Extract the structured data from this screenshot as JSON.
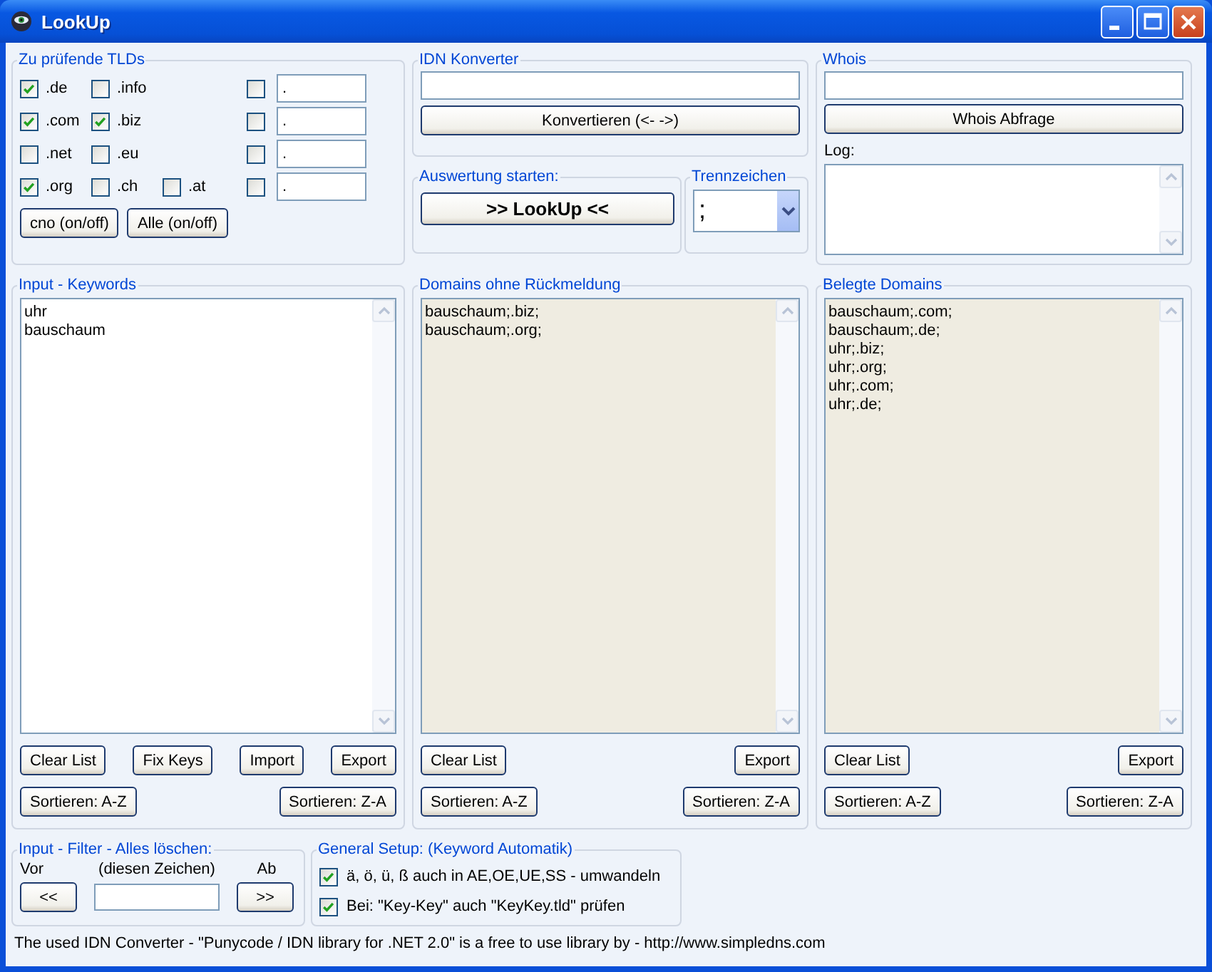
{
  "window": {
    "title": "LookUp"
  },
  "tld_group": {
    "title": "Zu prüfende TLDs",
    "rows": [
      {
        "tlds": [
          {
            "label": ".de",
            "checked": true
          },
          {
            "label": ".info",
            "checked": false
          }
        ],
        "custom": {
          "checked": false,
          "value": "."
        }
      },
      {
        "tlds": [
          {
            "label": ".com",
            "checked": true
          },
          {
            "label": ".biz",
            "checked": true
          }
        ],
        "custom": {
          "checked": false,
          "value": "."
        }
      },
      {
        "tlds": [
          {
            "label": ".net",
            "checked": false
          },
          {
            "label": ".eu",
            "checked": false
          }
        ],
        "custom": {
          "checked": false,
          "value": "."
        }
      },
      {
        "tlds": [
          {
            "label": ".org",
            "checked": true
          },
          {
            "label": ".ch",
            "checked": false
          },
          {
            "label": ".at",
            "checked": false
          }
        ],
        "custom": {
          "checked": false,
          "value": "."
        }
      }
    ],
    "buttons": [
      "cno (on/off)",
      "Alle (on/off)"
    ]
  },
  "idn": {
    "title": "IDN Konverter",
    "button": "Konvertieren (<- ->)"
  },
  "start": {
    "title": "Auswertung starten:",
    "button": ">> LookUp <<"
  },
  "separator": {
    "title": "Trennzeichen",
    "value": ";"
  },
  "whois": {
    "title": "Whois",
    "button": "Whois Abfrage",
    "log_label": "Log:"
  },
  "panels": [
    {
      "title": "Input - Keywords",
      "readonly": false,
      "lines": [
        "uhr",
        "bauschaum"
      ],
      "top_buttons": [
        "Clear List",
        "Fix Keys",
        "Import",
        "Export"
      ],
      "bottom_buttons": [
        "Sortieren: A-Z",
        "Sortieren: Z-A"
      ]
    },
    {
      "title": "Domains ohne Rückmeldung",
      "readonly": true,
      "lines": [
        "bauschaum;.biz;",
        "bauschaum;.org;"
      ],
      "top_buttons": [
        "Clear List",
        "Export"
      ],
      "bottom_buttons": [
        "Sortieren: A-Z",
        "Sortieren: Z-A"
      ]
    },
    {
      "title": "Belegte Domains",
      "readonly": true,
      "lines": [
        "bauschaum;.com;",
        "bauschaum;.de;",
        "uhr;.biz;",
        "uhr;.org;",
        "uhr;.com;",
        "uhr;.de;"
      ],
      "top_buttons": [
        "Clear List",
        "Export"
      ],
      "bottom_buttons": [
        "Sortieren: A-Z",
        "Sortieren: Z-A"
      ]
    }
  ],
  "filter": {
    "title": "Input - Filter - Alles löschen:",
    "labels": [
      "Vor",
      "(diesen Zeichen)",
      "Ab"
    ],
    "buttons": [
      "<<",
      ">>"
    ]
  },
  "setup": {
    "title": "General Setup: (Keyword Automatik)",
    "options": [
      {
        "label": "ä, ö, ü, ß auch in AE,OE,UE,SS - umwandeln",
        "checked": true
      },
      {
        "label": "Bei: \"Key-Key\" auch \"KeyKey.tld\" prüfen",
        "checked": true
      }
    ]
  },
  "footer": "The used IDN Converter - \"Punycode / IDN library for .NET 2.0\" is a free to use library by - http://www.simpledns.com"
}
